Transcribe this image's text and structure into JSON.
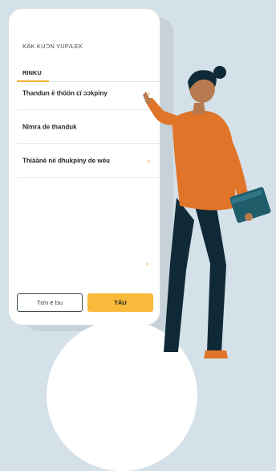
{
  "screen": {
    "eyebrow_title": "KÄK KUƆN YUP/LEK",
    "section_title": "RINKU",
    "rows": [
      {
        "label": "Thandun ë thöön cï ɔɔkpiny",
        "has_chevron": true
      },
      {
        "label": "Nïmra de thanduk",
        "has_chevron": false
      },
      {
        "label": "Thiäänë në dhukpiny de wëu",
        "has_chevron": true
      }
    ],
    "chevron_glyph": "›",
    "buttons": {
      "secondary_label": "Tεm ë lɔu",
      "primary_label": "TÄU"
    }
  },
  "colors": {
    "background": "#d4e1e9",
    "accent": "#f9b93b",
    "chevron": "#f0a53a",
    "shirt": "#e07428",
    "trousers": "#0f2a36",
    "book": "#1f5d6b"
  },
  "icons": [
    "chevron-right-icon",
    "chevron-right-icon",
    "chevron-right-icon"
  ]
}
